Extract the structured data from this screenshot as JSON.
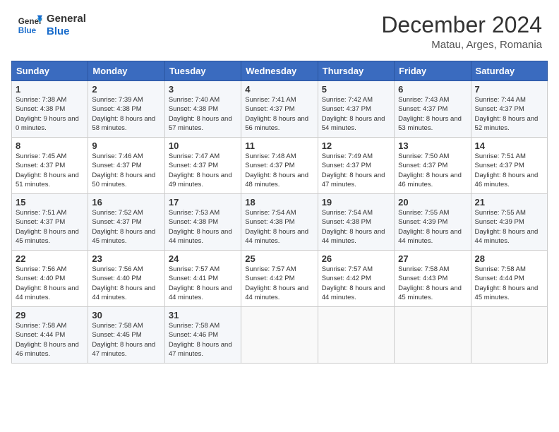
{
  "header": {
    "logo_line1": "General",
    "logo_line2": "Blue",
    "title": "December 2024",
    "subtitle": "Matau, Arges, Romania"
  },
  "days_of_week": [
    "Sunday",
    "Monday",
    "Tuesday",
    "Wednesday",
    "Thursday",
    "Friday",
    "Saturday"
  ],
  "weeks": [
    [
      {
        "day": "1",
        "sunrise": "Sunrise: 7:38 AM",
        "sunset": "Sunset: 4:38 PM",
        "daylight": "Daylight: 9 hours and 0 minutes."
      },
      {
        "day": "2",
        "sunrise": "Sunrise: 7:39 AM",
        "sunset": "Sunset: 4:38 PM",
        "daylight": "Daylight: 8 hours and 58 minutes."
      },
      {
        "day": "3",
        "sunrise": "Sunrise: 7:40 AM",
        "sunset": "Sunset: 4:38 PM",
        "daylight": "Daylight: 8 hours and 57 minutes."
      },
      {
        "day": "4",
        "sunrise": "Sunrise: 7:41 AM",
        "sunset": "Sunset: 4:37 PM",
        "daylight": "Daylight: 8 hours and 56 minutes."
      },
      {
        "day": "5",
        "sunrise": "Sunrise: 7:42 AM",
        "sunset": "Sunset: 4:37 PM",
        "daylight": "Daylight: 8 hours and 54 minutes."
      },
      {
        "day": "6",
        "sunrise": "Sunrise: 7:43 AM",
        "sunset": "Sunset: 4:37 PM",
        "daylight": "Daylight: 8 hours and 53 minutes."
      },
      {
        "day": "7",
        "sunrise": "Sunrise: 7:44 AM",
        "sunset": "Sunset: 4:37 PM",
        "daylight": "Daylight: 8 hours and 52 minutes."
      }
    ],
    [
      {
        "day": "8",
        "sunrise": "Sunrise: 7:45 AM",
        "sunset": "Sunset: 4:37 PM",
        "daylight": "Daylight: 8 hours and 51 minutes."
      },
      {
        "day": "9",
        "sunrise": "Sunrise: 7:46 AM",
        "sunset": "Sunset: 4:37 PM",
        "daylight": "Daylight: 8 hours and 50 minutes."
      },
      {
        "day": "10",
        "sunrise": "Sunrise: 7:47 AM",
        "sunset": "Sunset: 4:37 PM",
        "daylight": "Daylight: 8 hours and 49 minutes."
      },
      {
        "day": "11",
        "sunrise": "Sunrise: 7:48 AM",
        "sunset": "Sunset: 4:37 PM",
        "daylight": "Daylight: 8 hours and 48 minutes."
      },
      {
        "day": "12",
        "sunrise": "Sunrise: 7:49 AM",
        "sunset": "Sunset: 4:37 PM",
        "daylight": "Daylight: 8 hours and 47 minutes."
      },
      {
        "day": "13",
        "sunrise": "Sunrise: 7:50 AM",
        "sunset": "Sunset: 4:37 PM",
        "daylight": "Daylight: 8 hours and 46 minutes."
      },
      {
        "day": "14",
        "sunrise": "Sunrise: 7:51 AM",
        "sunset": "Sunset: 4:37 PM",
        "daylight": "Daylight: 8 hours and 46 minutes."
      }
    ],
    [
      {
        "day": "15",
        "sunrise": "Sunrise: 7:51 AM",
        "sunset": "Sunset: 4:37 PM",
        "daylight": "Daylight: 8 hours and 45 minutes."
      },
      {
        "day": "16",
        "sunrise": "Sunrise: 7:52 AM",
        "sunset": "Sunset: 4:37 PM",
        "daylight": "Daylight: 8 hours and 45 minutes."
      },
      {
        "day": "17",
        "sunrise": "Sunrise: 7:53 AM",
        "sunset": "Sunset: 4:38 PM",
        "daylight": "Daylight: 8 hours and 44 minutes."
      },
      {
        "day": "18",
        "sunrise": "Sunrise: 7:54 AM",
        "sunset": "Sunset: 4:38 PM",
        "daylight": "Daylight: 8 hours and 44 minutes."
      },
      {
        "day": "19",
        "sunrise": "Sunrise: 7:54 AM",
        "sunset": "Sunset: 4:38 PM",
        "daylight": "Daylight: 8 hours and 44 minutes."
      },
      {
        "day": "20",
        "sunrise": "Sunrise: 7:55 AM",
        "sunset": "Sunset: 4:39 PM",
        "daylight": "Daylight: 8 hours and 44 minutes."
      },
      {
        "day": "21",
        "sunrise": "Sunrise: 7:55 AM",
        "sunset": "Sunset: 4:39 PM",
        "daylight": "Daylight: 8 hours and 44 minutes."
      }
    ],
    [
      {
        "day": "22",
        "sunrise": "Sunrise: 7:56 AM",
        "sunset": "Sunset: 4:40 PM",
        "daylight": "Daylight: 8 hours and 44 minutes."
      },
      {
        "day": "23",
        "sunrise": "Sunrise: 7:56 AM",
        "sunset": "Sunset: 4:40 PM",
        "daylight": "Daylight: 8 hours and 44 minutes."
      },
      {
        "day": "24",
        "sunrise": "Sunrise: 7:57 AM",
        "sunset": "Sunset: 4:41 PM",
        "daylight": "Daylight: 8 hours and 44 minutes."
      },
      {
        "day": "25",
        "sunrise": "Sunrise: 7:57 AM",
        "sunset": "Sunset: 4:42 PM",
        "daylight": "Daylight: 8 hours and 44 minutes."
      },
      {
        "day": "26",
        "sunrise": "Sunrise: 7:57 AM",
        "sunset": "Sunset: 4:42 PM",
        "daylight": "Daylight: 8 hours and 44 minutes."
      },
      {
        "day": "27",
        "sunrise": "Sunrise: 7:58 AM",
        "sunset": "Sunset: 4:43 PM",
        "daylight": "Daylight: 8 hours and 45 minutes."
      },
      {
        "day": "28",
        "sunrise": "Sunrise: 7:58 AM",
        "sunset": "Sunset: 4:44 PM",
        "daylight": "Daylight: 8 hours and 45 minutes."
      }
    ],
    [
      {
        "day": "29",
        "sunrise": "Sunrise: 7:58 AM",
        "sunset": "Sunset: 4:44 PM",
        "daylight": "Daylight: 8 hours and 46 minutes."
      },
      {
        "day": "30",
        "sunrise": "Sunrise: 7:58 AM",
        "sunset": "Sunset: 4:45 PM",
        "daylight": "Daylight: 8 hours and 47 minutes."
      },
      {
        "day": "31",
        "sunrise": "Sunrise: 7:58 AM",
        "sunset": "Sunset: 4:46 PM",
        "daylight": "Daylight: 8 hours and 47 minutes."
      },
      null,
      null,
      null,
      null
    ]
  ]
}
